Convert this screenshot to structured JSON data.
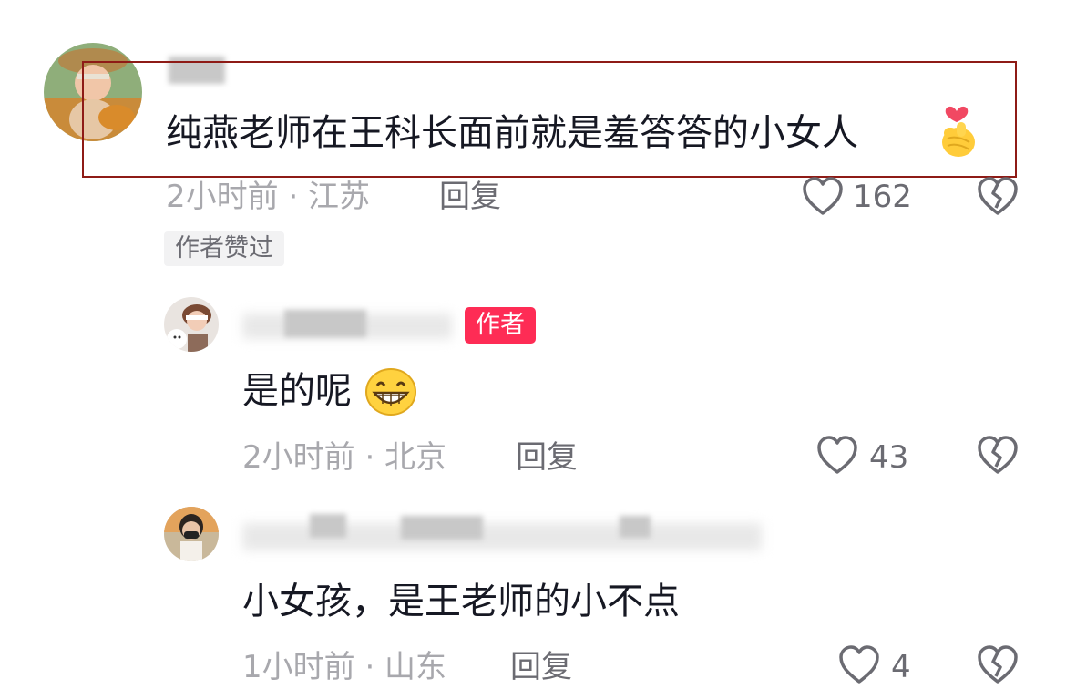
{
  "comments": [
    {
      "text": "纯燕老师在王科长面前就是羞答答的小女人",
      "emoji": "finger-heart",
      "meta": "2小时前 · 江苏",
      "reply_label": "回复",
      "likes": "162",
      "badge": "作者赞过",
      "highlighted": true
    },
    {
      "author_tag": "作者",
      "text": "是的呢",
      "emoji": "grinning-face",
      "meta": "2小时前 · 北京",
      "reply_label": "回复",
      "likes": "43"
    },
    {
      "text": "小女孩，是王老师的小不点",
      "meta": "1小时前 · 山东",
      "reply_label": "回复",
      "likes": "4"
    }
  ],
  "colors": {
    "highlight_border": "#8e1b16",
    "author_tag": "#fe2c55",
    "meta_text": "#a8a8ad",
    "icon": "#6b6b72"
  }
}
